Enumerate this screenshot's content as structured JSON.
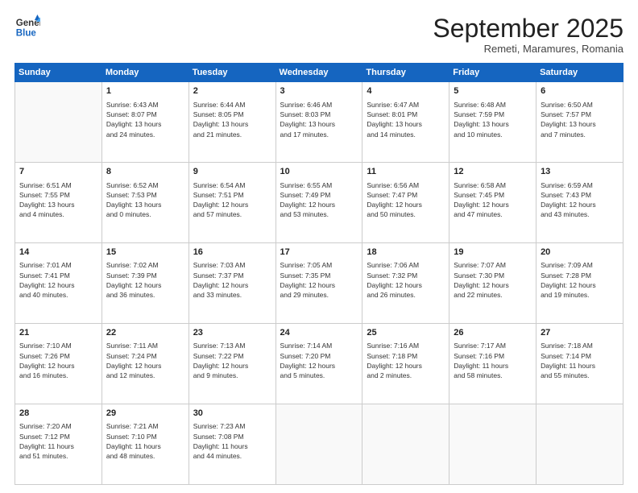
{
  "header": {
    "logo_line1": "General",
    "logo_line2": "Blue",
    "month": "September 2025",
    "location": "Remeti, Maramures, Romania"
  },
  "days_of_week": [
    "Sunday",
    "Monday",
    "Tuesday",
    "Wednesday",
    "Thursday",
    "Friday",
    "Saturday"
  ],
  "weeks": [
    [
      {
        "day": "",
        "info": ""
      },
      {
        "day": "1",
        "info": "Sunrise: 6:43 AM\nSunset: 8:07 PM\nDaylight: 13 hours\nand 24 minutes."
      },
      {
        "day": "2",
        "info": "Sunrise: 6:44 AM\nSunset: 8:05 PM\nDaylight: 13 hours\nand 21 minutes."
      },
      {
        "day": "3",
        "info": "Sunrise: 6:46 AM\nSunset: 8:03 PM\nDaylight: 13 hours\nand 17 minutes."
      },
      {
        "day": "4",
        "info": "Sunrise: 6:47 AM\nSunset: 8:01 PM\nDaylight: 13 hours\nand 14 minutes."
      },
      {
        "day": "5",
        "info": "Sunrise: 6:48 AM\nSunset: 7:59 PM\nDaylight: 13 hours\nand 10 minutes."
      },
      {
        "day": "6",
        "info": "Sunrise: 6:50 AM\nSunset: 7:57 PM\nDaylight: 13 hours\nand 7 minutes."
      }
    ],
    [
      {
        "day": "7",
        "info": "Sunrise: 6:51 AM\nSunset: 7:55 PM\nDaylight: 13 hours\nand 4 minutes."
      },
      {
        "day": "8",
        "info": "Sunrise: 6:52 AM\nSunset: 7:53 PM\nDaylight: 13 hours\nand 0 minutes."
      },
      {
        "day": "9",
        "info": "Sunrise: 6:54 AM\nSunset: 7:51 PM\nDaylight: 12 hours\nand 57 minutes."
      },
      {
        "day": "10",
        "info": "Sunrise: 6:55 AM\nSunset: 7:49 PM\nDaylight: 12 hours\nand 53 minutes."
      },
      {
        "day": "11",
        "info": "Sunrise: 6:56 AM\nSunset: 7:47 PM\nDaylight: 12 hours\nand 50 minutes."
      },
      {
        "day": "12",
        "info": "Sunrise: 6:58 AM\nSunset: 7:45 PM\nDaylight: 12 hours\nand 47 minutes."
      },
      {
        "day": "13",
        "info": "Sunrise: 6:59 AM\nSunset: 7:43 PM\nDaylight: 12 hours\nand 43 minutes."
      }
    ],
    [
      {
        "day": "14",
        "info": "Sunrise: 7:01 AM\nSunset: 7:41 PM\nDaylight: 12 hours\nand 40 minutes."
      },
      {
        "day": "15",
        "info": "Sunrise: 7:02 AM\nSunset: 7:39 PM\nDaylight: 12 hours\nand 36 minutes."
      },
      {
        "day": "16",
        "info": "Sunrise: 7:03 AM\nSunset: 7:37 PM\nDaylight: 12 hours\nand 33 minutes."
      },
      {
        "day": "17",
        "info": "Sunrise: 7:05 AM\nSunset: 7:35 PM\nDaylight: 12 hours\nand 29 minutes."
      },
      {
        "day": "18",
        "info": "Sunrise: 7:06 AM\nSunset: 7:32 PM\nDaylight: 12 hours\nand 26 minutes."
      },
      {
        "day": "19",
        "info": "Sunrise: 7:07 AM\nSunset: 7:30 PM\nDaylight: 12 hours\nand 22 minutes."
      },
      {
        "day": "20",
        "info": "Sunrise: 7:09 AM\nSunset: 7:28 PM\nDaylight: 12 hours\nand 19 minutes."
      }
    ],
    [
      {
        "day": "21",
        "info": "Sunrise: 7:10 AM\nSunset: 7:26 PM\nDaylight: 12 hours\nand 16 minutes."
      },
      {
        "day": "22",
        "info": "Sunrise: 7:11 AM\nSunset: 7:24 PM\nDaylight: 12 hours\nand 12 minutes."
      },
      {
        "day": "23",
        "info": "Sunrise: 7:13 AM\nSunset: 7:22 PM\nDaylight: 12 hours\nand 9 minutes."
      },
      {
        "day": "24",
        "info": "Sunrise: 7:14 AM\nSunset: 7:20 PM\nDaylight: 12 hours\nand 5 minutes."
      },
      {
        "day": "25",
        "info": "Sunrise: 7:16 AM\nSunset: 7:18 PM\nDaylight: 12 hours\nand 2 minutes."
      },
      {
        "day": "26",
        "info": "Sunrise: 7:17 AM\nSunset: 7:16 PM\nDaylight: 11 hours\nand 58 minutes."
      },
      {
        "day": "27",
        "info": "Sunrise: 7:18 AM\nSunset: 7:14 PM\nDaylight: 11 hours\nand 55 minutes."
      }
    ],
    [
      {
        "day": "28",
        "info": "Sunrise: 7:20 AM\nSunset: 7:12 PM\nDaylight: 11 hours\nand 51 minutes."
      },
      {
        "day": "29",
        "info": "Sunrise: 7:21 AM\nSunset: 7:10 PM\nDaylight: 11 hours\nand 48 minutes."
      },
      {
        "day": "30",
        "info": "Sunrise: 7:23 AM\nSunset: 7:08 PM\nDaylight: 11 hours\nand 44 minutes."
      },
      {
        "day": "",
        "info": ""
      },
      {
        "day": "",
        "info": ""
      },
      {
        "day": "",
        "info": ""
      },
      {
        "day": "",
        "info": ""
      }
    ]
  ]
}
